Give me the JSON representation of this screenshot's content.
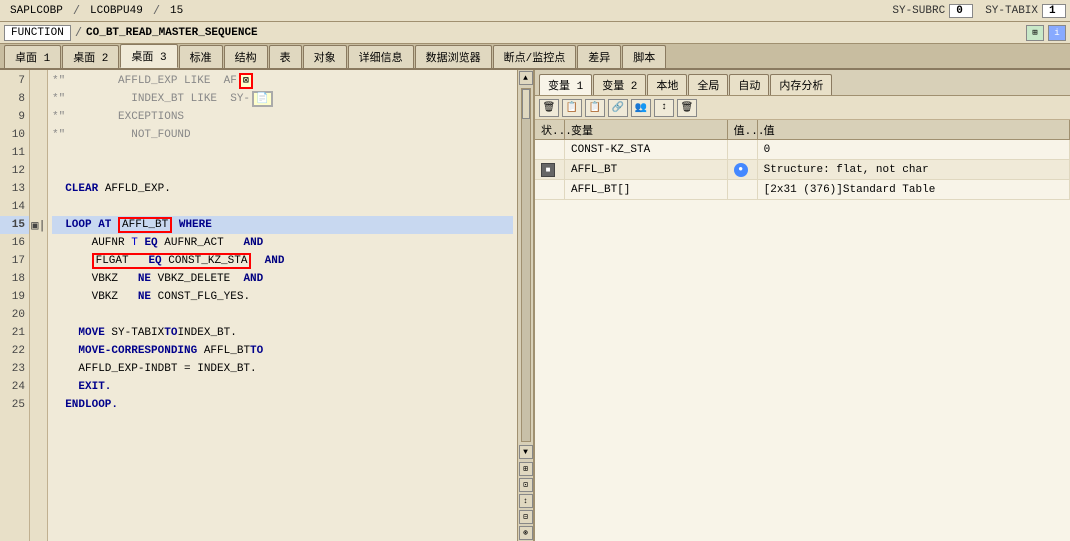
{
  "topbar": {
    "program": "SAPLCOBP",
    "sep1": "/",
    "include": "LCOBPU49",
    "sep2": "/",
    "line": "15",
    "sy_subrc_label": "SY-SUBRC",
    "sy_subrc_value": "0",
    "sy_tabix_label": "SY-TABIX",
    "sy_tabix_value": "1"
  },
  "secondbar": {
    "func_label": "FUNCTION",
    "sep": "/",
    "func_name": "CO_BT_READ_MASTER_SEQUENCE"
  },
  "tabs": {
    "items": [
      "卓面 1",
      "桌面 2",
      "桌面 3",
      "标准",
      "结构",
      "表",
      "对象",
      "详细信息",
      "数据浏览器",
      "断点/监控点",
      "差异",
      "脚本"
    ],
    "active": 2
  },
  "code": {
    "lines": [
      {
        "num": 7,
        "fold": "",
        "content": "*\"        AFFLD_EXP LIKE  AF"
      },
      {
        "num": 8,
        "fold": "",
        "content": "*\"          INDEX_BT LIKE  SY-"
      },
      {
        "num": 9,
        "fold": "",
        "content": "*\"        EXCEPTIONS"
      },
      {
        "num": 10,
        "fold": "",
        "content": "*\"          NOT_FOUND"
      },
      {
        "num": 11,
        "fold": "",
        "content": ""
      },
      {
        "num": 12,
        "fold": "",
        "content": ""
      },
      {
        "num": 13,
        "fold": "",
        "content": "  CLEAR AFFLD_EXP."
      },
      {
        "num": 14,
        "fold": "",
        "content": ""
      },
      {
        "num": 15,
        "fold": "▣|",
        "content": "  LOOP AT AFFL_BT WHERE"
      },
      {
        "num": 16,
        "fold": "",
        "content": "      AUFNR T EQ AUFNR_ACT    AND"
      },
      {
        "num": 17,
        "fold": "",
        "content": "      FLGAT   EQ CONST_KZ_STA  AND"
      },
      {
        "num": 18,
        "fold": "",
        "content": "      VBKZ   NE VBKZ_DELETE   AND"
      },
      {
        "num": 19,
        "fold": "",
        "content": "      VBKZ   NE CONST_FLG_YES."
      },
      {
        "num": 20,
        "fold": "",
        "content": ""
      },
      {
        "num": 21,
        "fold": "",
        "content": "    MOVE SY-TABIX TO INDEX_BT."
      },
      {
        "num": 22,
        "fold": "",
        "content": "    MOVE-CORRESPONDING AFFL_BT TO"
      },
      {
        "num": 23,
        "fold": "",
        "content": "    AFFLD_EXP-INDBT = INDEX_BT."
      },
      {
        "num": 24,
        "fold": "",
        "content": "    EXIT."
      },
      {
        "num": 25,
        "fold": "",
        "content": "  ENDLOOP."
      }
    ]
  },
  "var_panel": {
    "tabs": [
      "变量 1",
      "变量 2",
      "本地",
      "全局",
      "自动",
      "内存分析"
    ],
    "active": 0,
    "columns": {
      "status": "状...",
      "name": "变量",
      "val_short": "值...",
      "value": "值"
    },
    "rows": [
      {
        "status": "",
        "name": "CONST-KZ_STA",
        "val_short": "",
        "value": "0"
      },
      {
        "status": "■",
        "name": "AFFL_BT",
        "val_short": "🔵",
        "value": "Structure: flat, not char"
      },
      {
        "status": "",
        "name": "AFFL_BT[]",
        "val_short": "",
        "value": "[2x31 (376)]Standard Table"
      }
    ]
  },
  "icons": {
    "trash": "🗑",
    "copy1": "📋",
    "copy2": "📋",
    "link": "🔗",
    "people": "👥",
    "arrow": "↕",
    "trash2": "🗑"
  }
}
